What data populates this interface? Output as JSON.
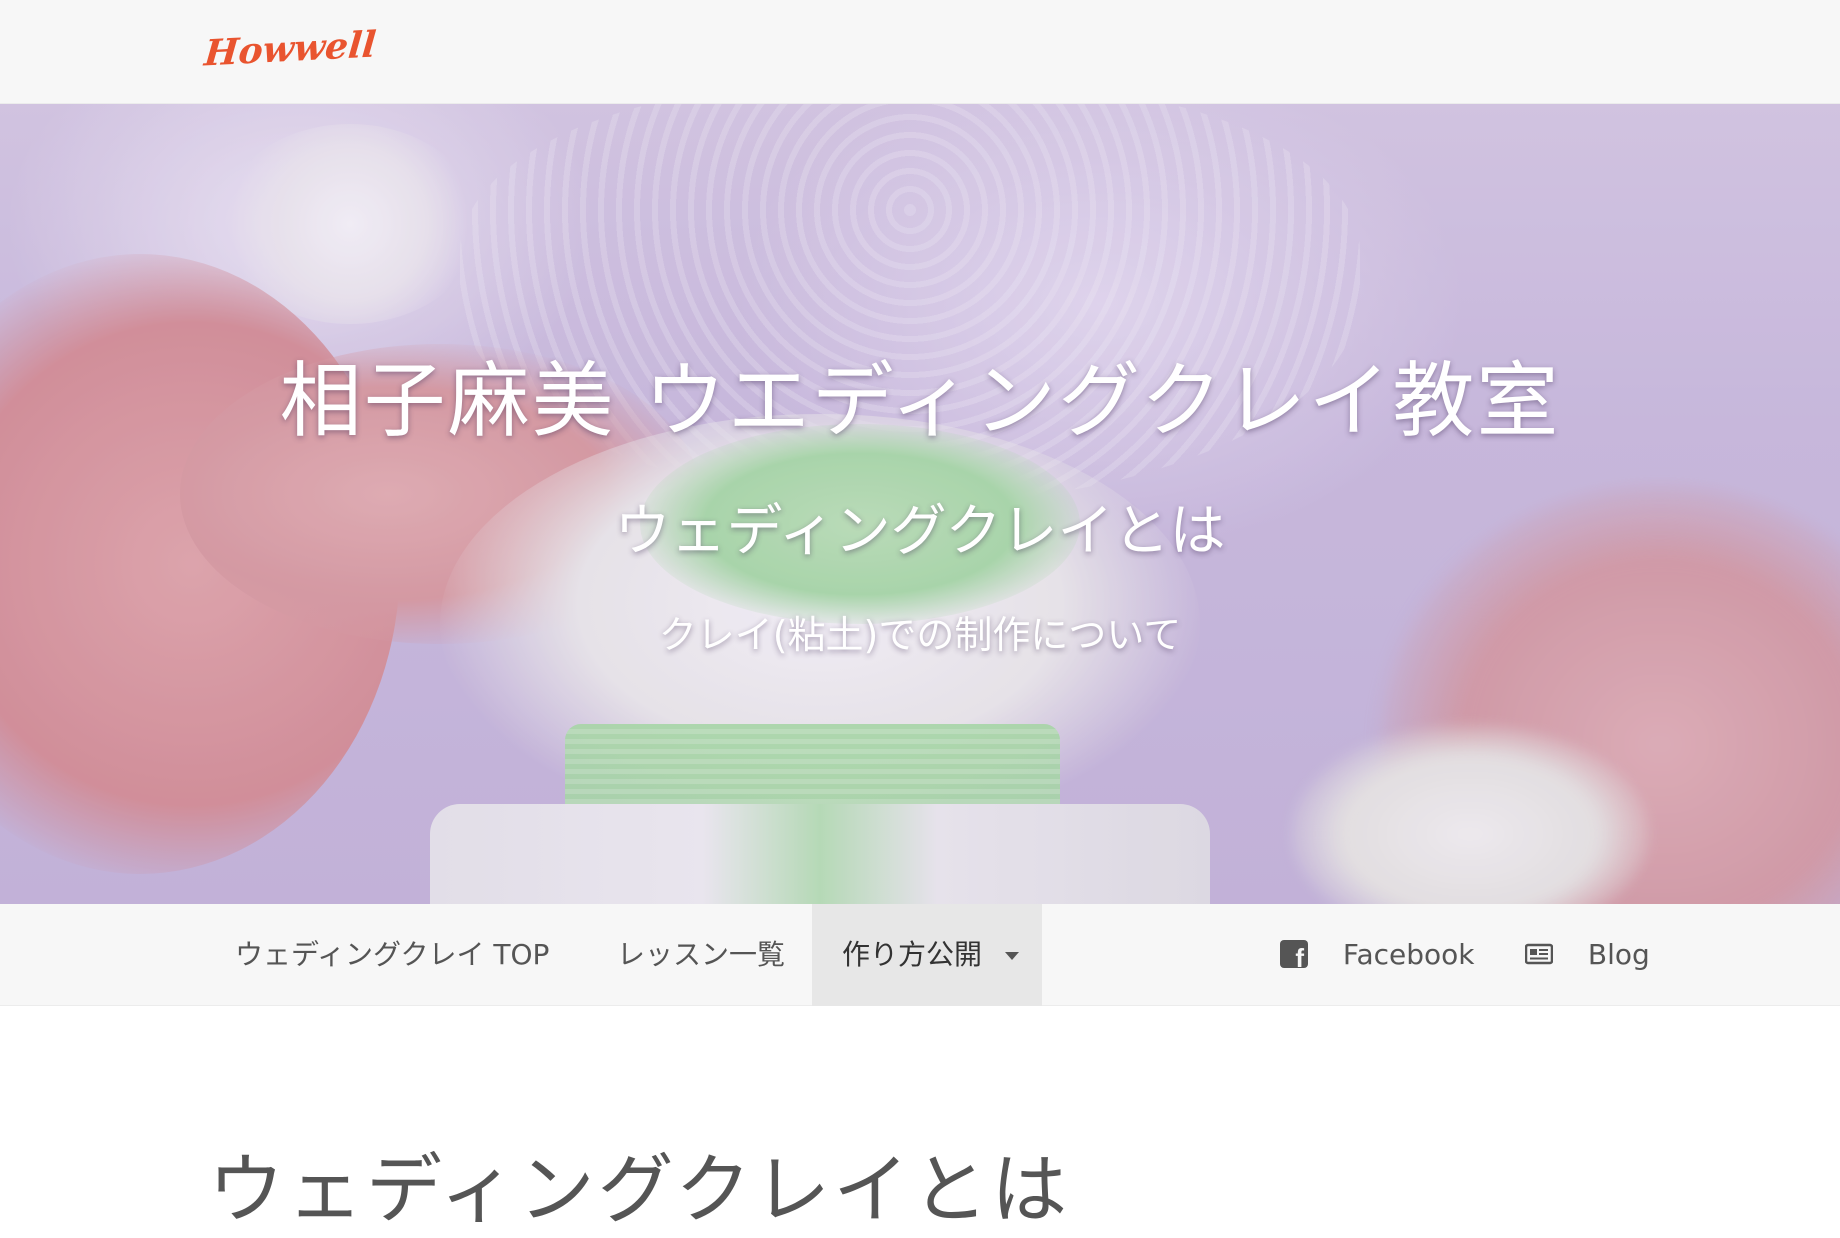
{
  "header": {
    "logo_text": "Howwell"
  },
  "hero": {
    "title": "相子麻美 ウエディングクレイ教室",
    "subtitle": "ウェディングクレイとは",
    "tagline": "クレイ(粘土)での制作について"
  },
  "nav": {
    "items": [
      {
        "label": "ウェディングクレイ TOP"
      },
      {
        "label": "レッスン一覧"
      },
      {
        "label": "作り方公開",
        "active": true,
        "dropdown": true
      }
    ],
    "social": [
      {
        "label": "Facebook",
        "icon": "facebook-icon"
      },
      {
        "label": "Blog",
        "icon": "blog-icon"
      }
    ]
  },
  "content": {
    "heading": "ウェディングクレイとは"
  },
  "colors": {
    "logo": "#e9542f",
    "nav_bg": "#f7f7f7",
    "nav_active_bg": "#e7e7e7",
    "text": "#555555"
  }
}
